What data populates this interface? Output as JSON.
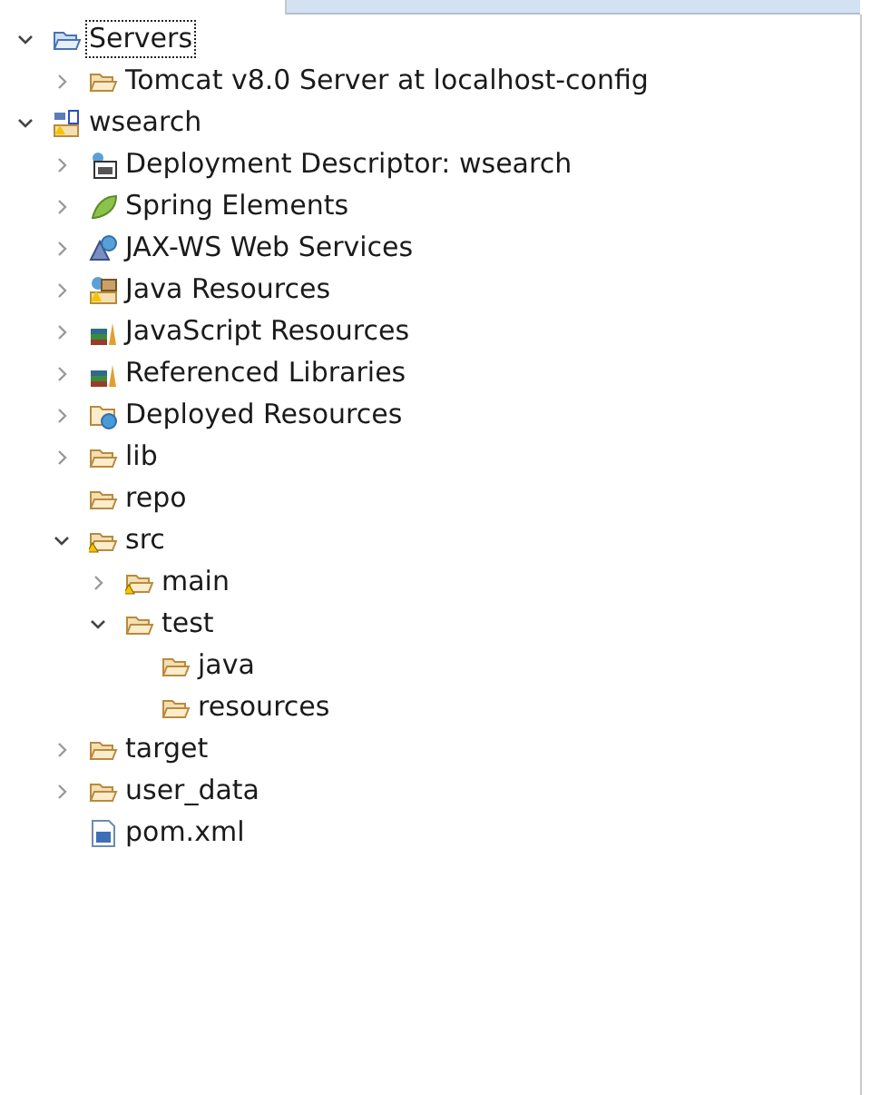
{
  "tree": [
    {
      "label": "Servers",
      "kind": "servers",
      "expandable": true,
      "expanded": true,
      "selected": true,
      "children": [
        {
          "label": "Tomcat v8.0 Server at localhost-config",
          "kind": "folder",
          "expandable": true,
          "expanded": false,
          "selected": false
        }
      ]
    },
    {
      "label": "wsearch",
      "kind": "project",
      "expandable": true,
      "expanded": true,
      "selected": false,
      "children": [
        {
          "label": "Deployment Descriptor: wsearch",
          "kind": "descriptor",
          "expandable": true,
          "expanded": false,
          "selected": false
        },
        {
          "label": "Spring Elements",
          "kind": "leaf",
          "expandable": true,
          "expanded": false,
          "selected": false
        },
        {
          "label": "JAX-WS Web Services",
          "kind": "webservice",
          "expandable": true,
          "expanded": false,
          "selected": false
        },
        {
          "label": "Java Resources",
          "kind": "javares",
          "expandable": true,
          "expanded": false,
          "selected": false
        },
        {
          "label": "JavaScript Resources",
          "kind": "library",
          "expandable": true,
          "expanded": false,
          "selected": false
        },
        {
          "label": "Referenced Libraries",
          "kind": "library",
          "expandable": true,
          "expanded": false,
          "selected": false
        },
        {
          "label": "Deployed Resources",
          "kind": "deployed",
          "expandable": true,
          "expanded": false,
          "selected": false
        },
        {
          "label": "lib",
          "kind": "folder",
          "expandable": true,
          "expanded": false,
          "selected": false
        },
        {
          "label": "repo",
          "kind": "folder",
          "expandable": false,
          "selected": false
        },
        {
          "label": "src",
          "kind": "folder-warning",
          "expandable": true,
          "expanded": true,
          "selected": false,
          "children": [
            {
              "label": "main",
              "kind": "folder-warning",
              "expandable": true,
              "expanded": false,
              "selected": false
            },
            {
              "label": "test",
              "kind": "folder",
              "expandable": true,
              "expanded": true,
              "selected": false,
              "children": [
                {
                  "label": "java",
                  "kind": "folder",
                  "expandable": false,
                  "selected": false
                },
                {
                  "label": "resources",
                  "kind": "folder",
                  "expandable": false,
                  "selected": false
                }
              ]
            }
          ]
        },
        {
          "label": "target",
          "kind": "folder",
          "expandable": true,
          "expanded": false,
          "selected": false
        },
        {
          "label": "user_data",
          "kind": "folder",
          "expandable": true,
          "expanded": false,
          "selected": false
        },
        {
          "label": "pom.xml",
          "kind": "maven-file",
          "expandable": false,
          "selected": false
        }
      ]
    }
  ]
}
